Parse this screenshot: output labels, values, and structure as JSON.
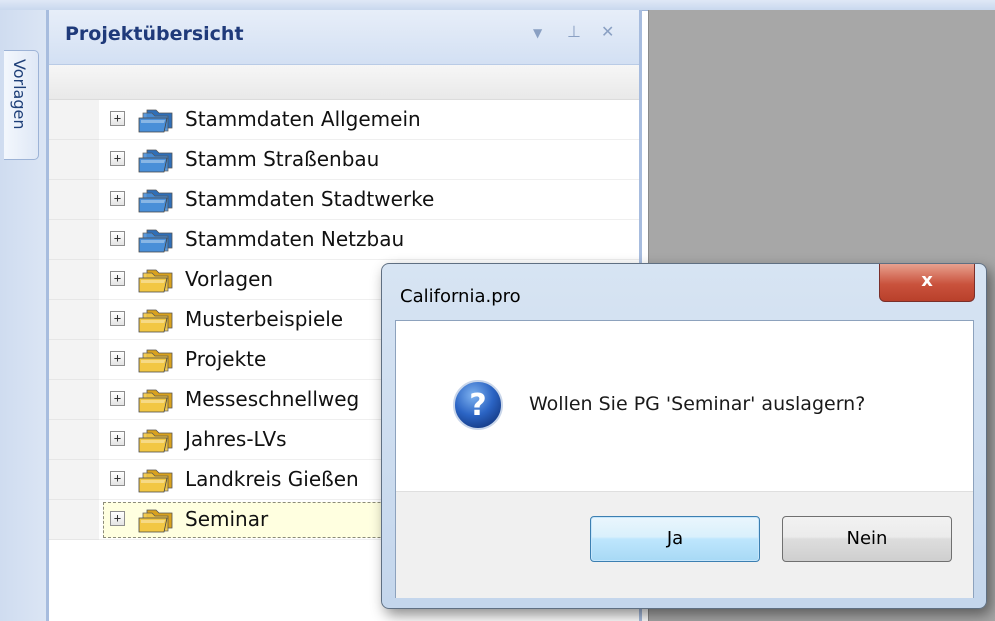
{
  "side_tab": {
    "label": "Vorlagen"
  },
  "panel": {
    "title": "Projektübersicht",
    "header_icons": {
      "dropdown": "▼",
      "pin": "⊥",
      "close": "✕"
    }
  },
  "tree": {
    "items": [
      {
        "label": "Stammdaten Allgemein",
        "folder": "blue"
      },
      {
        "label": "Stamm Straßenbau",
        "folder": "blue"
      },
      {
        "label": "Stammdaten Stadtwerke",
        "folder": "blue"
      },
      {
        "label": "Stammdaten Netzbau",
        "folder": "blue"
      },
      {
        "label": "Vorlagen",
        "folder": "yellow"
      },
      {
        "label": "Musterbeispiele",
        "folder": "yellow"
      },
      {
        "label": "Projekte",
        "folder": "yellow"
      },
      {
        "label": "Messeschnellweg",
        "folder": "yellow"
      },
      {
        "label": "Jahres-LVs",
        "folder": "yellow"
      },
      {
        "label": "Landkreis Gießen",
        "folder": "yellow"
      },
      {
        "label": "Seminar",
        "folder": "yellow",
        "selected": true
      }
    ],
    "expander_glyph": "+"
  },
  "dialog": {
    "title": "California.pro",
    "close_glyph": "x",
    "icon_glyph": "?",
    "message": "Wollen Sie PG 'Seminar' auslagern?",
    "yes_label": "Ja",
    "no_label": "Nein"
  },
  "colors": {
    "folder_blue": "#4a8fd8",
    "folder_yellow": "#f2c744",
    "selection": "#ffffe0",
    "title_text": "#1f3a7a"
  }
}
